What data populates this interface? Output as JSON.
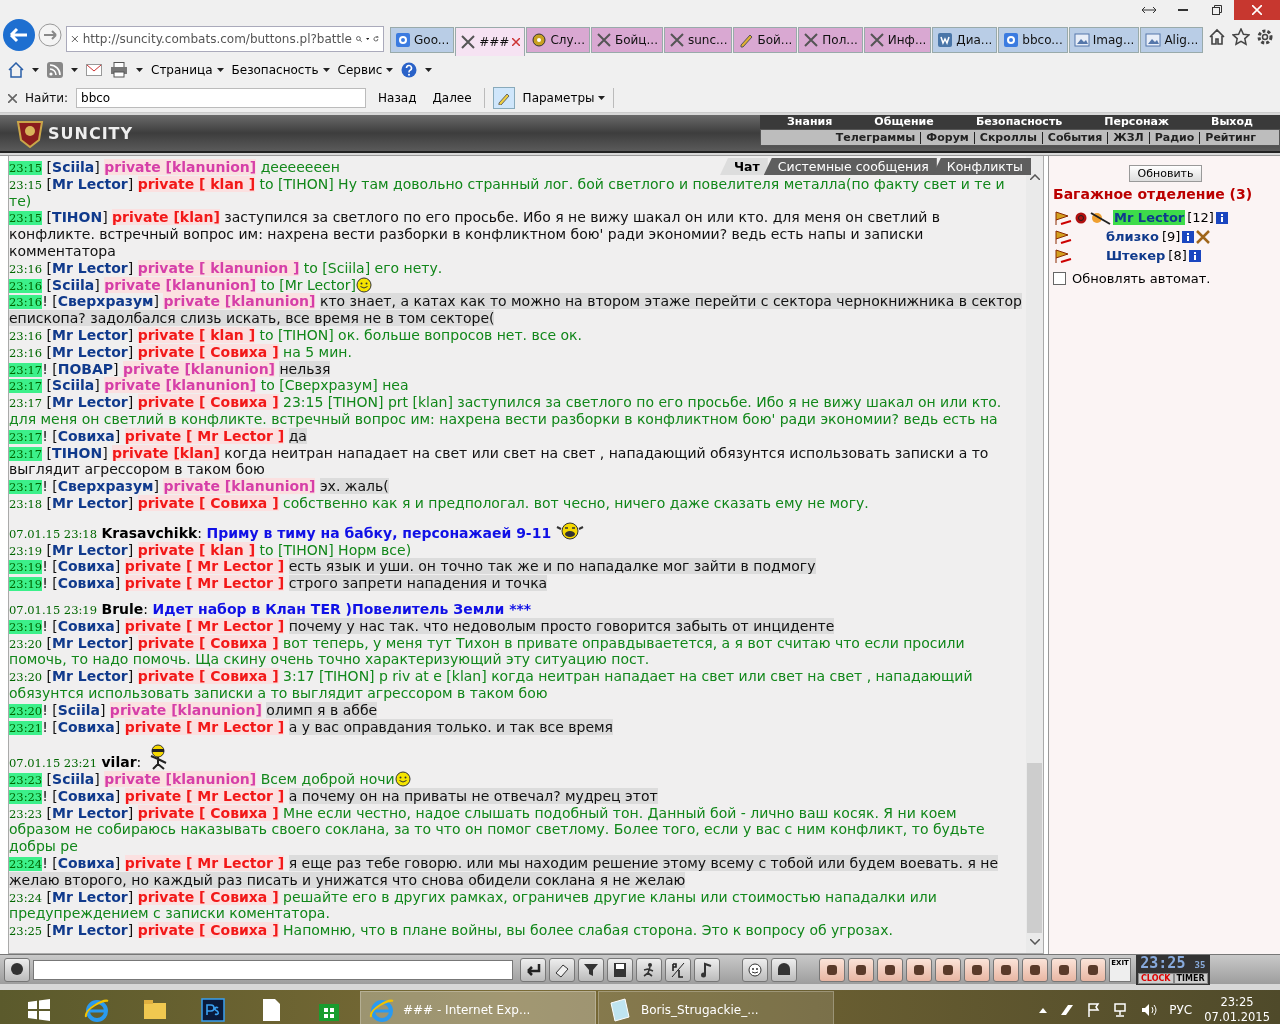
{
  "browser": {
    "url": "http://suncity.combats.com/buttons.pl?battle",
    "tabs": [
      {
        "label": "Goo...",
        "kind": "search",
        "color": "#b9cde6",
        "selected": false
      },
      {
        "label": "###",
        "kind": "swords",
        "color": "#f6e3f3",
        "selected": true
      },
      {
        "label": "Слу...",
        "kind": "gear",
        "color": "#d9a8d2",
        "selected": false
      },
      {
        "label": "Бойц...",
        "kind": "swords",
        "color": "#d9a8d2",
        "selected": false
      },
      {
        "label": "sunc...",
        "kind": "swords",
        "color": "#d9a8d2",
        "selected": false
      },
      {
        "label": "Бой...",
        "kind": "pen",
        "color": "#d9a8d2",
        "selected": false
      },
      {
        "label": "Пол...",
        "kind": "swords",
        "color": "#d9a8d2",
        "selected": false
      },
      {
        "label": "Инф...",
        "kind": "swords",
        "color": "#d9a8d2",
        "selected": false
      },
      {
        "label": "Диа...",
        "kind": "vk",
        "color": "#b9cde6",
        "selected": false
      },
      {
        "label": "bbco...",
        "kind": "search",
        "color": "#b9cde6",
        "selected": false
      },
      {
        "label": "Imag...",
        "kind": "image",
        "color": "#b9cde6",
        "selected": false
      },
      {
        "label": "Alig...",
        "kind": "image",
        "color": "#b9cde6",
        "selected": false
      }
    ],
    "menus": [
      "Страница",
      "Безопасность",
      "Сервис"
    ],
    "find": {
      "label": "Найти:",
      "value": "bbco",
      "prev": "Назад",
      "next": "Далее",
      "options": "Параметры"
    }
  },
  "game": {
    "logo": "SUNCITY",
    "nav_top": [
      "Знания",
      "Общение",
      "Безопасность",
      "Персонаж",
      "Выход"
    ],
    "nav_bottom": [
      "Телеграммы",
      "Форум",
      "Скроллы",
      "События",
      "ЖЗЛ",
      "Радио",
      "Рейтинг"
    ],
    "tabs": [
      {
        "label": "Чат",
        "selected": true
      },
      {
        "label": "Системные сообщения",
        "selected": false
      },
      {
        "label": "Конфликты",
        "selected": false
      }
    ]
  },
  "chat": [
    {
      "kind": "private",
      "time": "23:15",
      "time_marked": true,
      "sender": "[**Sciila**]",
      "channel": {
        "label": "private [klanunion]",
        "color": "#d63fa8"
      },
      "body": {
        "text": "дееееееен",
        "color": "#11871a",
        "shaded": false
      }
    },
    {
      "kind": "private",
      "time": "23:15",
      "time_marked": false,
      "sender": "[**Mr Lector**]",
      "channel": {
        "label": "private [ klan ]",
        "color": "#f21818"
      },
      "body": {
        "text": "to [TIHON] Ну там довольно странный лог. бой светлого и повелителя металла(по факту свет и те и те)",
        "color": "#11871a",
        "shaded": false
      }
    },
    {
      "kind": "private",
      "time": "23:15",
      "time_marked": true,
      "sender": "[**TIHON**]",
      "channel": {
        "label": "private [klan]",
        "color": "#f21818"
      },
      "body": {
        "text": "заступился за светлого по его просьбе. Ибо я не вижу шакал он или кто. для меня он светлий в конфликте. встречный вопрос им: нахрена вести разборки в конфликтном бою' ради экономии? ведь есть напы и записки комментатора",
        "color": "#111111",
        "shaded": false
      }
    },
    {
      "kind": "private",
      "time": "23:16",
      "time_marked": false,
      "sender": "[**Mr Lector**]",
      "channel": {
        "label": "private [ klanunion ]",
        "color": "#d63fa8"
      },
      "body": {
        "text": "to [Sciila] его нету.",
        "color": "#11871a",
        "shaded": false
      }
    },
    {
      "kind": "private",
      "time": "23:16",
      "time_marked": true,
      "sender": "[**Sciila**]",
      "channel": {
        "label": "private [klanunion]",
        "color": "#d63fa8"
      },
      "body": {
        "text": "to [Mr Lector]",
        "color": "#11871a",
        "shaded": false
      },
      "emoticon": {
        "kind": "smile"
      }
    },
    {
      "kind": "private",
      "time": "23:16",
      "time_marked": true,
      "prefix": "!",
      "sender": "[**Сверхразум**]",
      "channel": {
        "label": "private [klanunion]",
        "color": "#d63fa8"
      },
      "body": {
        "text": "кто знает, а катах как то можно на втором этаже перейти с сектора чернокнижника в сектор епископа? задолбался слизь искать, все время не в том секторе(",
        "color": "#111111",
        "shaded": true
      }
    },
    {
      "kind": "private",
      "time": "23:16",
      "time_marked": false,
      "sender": "[**Mr Lector**]",
      "channel": {
        "label": "private [ klan ]",
        "color": "#f21818"
      },
      "body": {
        "text": "to [TIHON] ок. больше вопросов нет. все ок.",
        "color": "#11871a",
        "shaded": false
      }
    },
    {
      "kind": "private",
      "time": "23:16",
      "time_marked": false,
      "sender": "[**Mr Lector**]",
      "channel": {
        "label": "private [ Совиха ]",
        "color": "#f21818"
      },
      "body": {
        "text": "на 5 мин.",
        "color": "#11871a",
        "shaded": false
      }
    },
    {
      "kind": "private",
      "time": "23:17",
      "time_marked": true,
      "prefix": "!",
      "sender": "[**ПОВАР**]",
      "channel": {
        "label": "private [klanunion]",
        "color": "#d63fa8"
      },
      "body": {
        "text": "нельзя",
        "color": "#111111",
        "shaded": true
      }
    },
    {
      "kind": "private",
      "time": "23:17",
      "time_marked": true,
      "sender": "[**Sciila**]",
      "channel": {
        "label": "private [klanunion]",
        "color": "#d63fa8"
      },
      "body": {
        "text": "to [Сверхразум] неа",
        "color": "#11871a",
        "shaded": false
      }
    },
    {
      "kind": "private",
      "time": "23:17",
      "time_marked": false,
      "sender": "[**Mr Lector**]",
      "channel": {
        "label": "private [ Совиха ]",
        "color": "#f21818"
      },
      "body": {
        "text": "23:15 [TIHON] prt [klan] заступился за светлого по его просьбе. Ибо я не вижу шакал он или кто. для меня он светлий в конфликте. встречный вопрос им: нахрена вести разборки в конфликтном бою' ради экономии? ведь есть на",
        "color": "#11871a",
        "shaded": false
      }
    },
    {
      "kind": "private",
      "time": "23:17",
      "time_marked": true,
      "prefix": "!",
      "sender": "[**Совиха**]",
      "channel": {
        "label": "private [ Mr Lector ]",
        "color": "#f21818"
      },
      "body": {
        "text": "да",
        "color": "#111111",
        "shaded": true
      }
    },
    {
      "kind": "private",
      "time": "23:17",
      "time_marked": true,
      "sender": "[**TIHON**]",
      "channel": {
        "label": "private [klan]",
        "color": "#f21818"
      },
      "body": {
        "text": "когда неитран нападает на свет или свет на свет , нападающий обязунтся использовать записки а то выглядит агрессором в таком бою",
        "color": "#111111",
        "shaded": false
      }
    },
    {
      "kind": "private",
      "time": "23:17",
      "time_marked": true,
      "prefix": "!",
      "sender": "[**Сверхразум**]",
      "channel": {
        "label": "private [klanunion]",
        "color": "#d63fa8"
      },
      "body": {
        "text": "эх. жаль(",
        "color": "#111111",
        "shaded": true
      }
    },
    {
      "kind": "private",
      "time": "23:18",
      "time_marked": false,
      "sender": "[**Mr Lector**]",
      "channel": {
        "label": "private [ Совиха ]",
        "color": "#f21818"
      },
      "body": {
        "text": "собственно как я и предпологал. вот чесно, ничего даже сказать ему не могу.",
        "color": "#11871a",
        "shaded": false
      }
    },
    {
      "kind": "broadcast",
      "time": "07.01.15 23:18",
      "sender": "**Krasavchikk**:",
      "text": "Приму в тиму на бабку, персонажаей 9-11",
      "emoticon": {
        "kind": "laugh"
      }
    },
    {
      "kind": "private",
      "time": "23:19",
      "time_marked": false,
      "sender": "[**Mr Lector**]",
      "channel": {
        "label": "private [ klan ]",
        "color": "#f21818"
      },
      "body": {
        "text": "to [TIHON] Норм все)",
        "color": "#11871a",
        "shaded": false
      }
    },
    {
      "kind": "private",
      "time": "23:19",
      "time_marked": true,
      "prefix": "!",
      "sender": "[**Совиха**]",
      "channel": {
        "label": "private [ Mr Lector ]",
        "color": "#f21818"
      },
      "body": {
        "text": "есть язык и уши. он точно так же и по нападалке мог зайти в подмогу",
        "color": "#111111",
        "shaded": true
      }
    },
    {
      "kind": "private",
      "time": "23:19",
      "time_marked": true,
      "prefix": "!",
      "sender": "[**Совиха**]",
      "channel": {
        "label": "private [ Mr Lector ]",
        "color": "#f21818"
      },
      "body": {
        "text": "строго запрети нападения и точка",
        "color": "#111111",
        "shaded": true
      }
    },
    {
      "kind": "broadcast",
      "time": "07.01.15 23:19",
      "sender": "**Brule**:",
      "text": "Идет набор в Клан TER )Повелитель Земли ***"
    },
    {
      "kind": "private",
      "time": "23:19",
      "time_marked": true,
      "prefix": "!",
      "sender": "[**Совиха**]",
      "channel": {
        "label": "private [ Mr Lector ]",
        "color": "#f21818"
      },
      "body": {
        "text": "почему у нас так. что недоволым просто говорится забыть от инциденте",
        "color": "#111111",
        "shaded": true
      }
    },
    {
      "kind": "private",
      "time": "23:20",
      "time_marked": false,
      "sender": "[**Mr Lector**]",
      "channel": {
        "label": "private [ Совиха ]",
        "color": "#f21818"
      },
      "body": {
        "text": "вот теперь, у меня тут Тихон в привате оправдываетется, а я вот считаю что если просили помочь, то надо помочь. Ща скину очень точно характеризующий эту ситуацию пост.",
        "color": "#11871a",
        "shaded": false
      }
    },
    {
      "kind": "private",
      "time": "23:20",
      "time_marked": false,
      "sender": "[**Mr Lector**]",
      "channel": {
        "label": "private [ Совиха ]",
        "color": "#f21818"
      },
      "body": {
        "text": "3:17 [TIHON] p riv at e [klan] когда неитран нападает на свет или свет на свет , нападающий обязунтся использовать записки а то выглядит агрессором в таком бою",
        "color": "#11871a",
        "shaded": false
      }
    },
    {
      "kind": "private",
      "time": "23:20",
      "time_marked": true,
      "prefix": "!",
      "sender": "[**Sciila**]",
      "channel": {
        "label": "private [klanunion]",
        "color": "#d63fa8"
      },
      "body": {
        "text": "олимп я в аббе",
        "color": "#111111",
        "shaded": true
      }
    },
    {
      "kind": "private",
      "time": "23:21",
      "time_marked": true,
      "prefix": "!",
      "sender": "[**Совиха**]",
      "channel": {
        "label": "private [ Mr Lector ]",
        "color": "#f21818"
      },
      "body": {
        "text": "а у вас оправдания только. и так все время",
        "color": "#111111",
        "shaded": true
      }
    },
    {
      "kind": "broadcast",
      "time": "07.01.15 23:21",
      "sender": "**vilar**:",
      "emoticon": {
        "kind": "dancer"
      }
    },
    {
      "kind": "private",
      "time": "23:23",
      "time_marked": true,
      "sender": "[**Sciila**]",
      "channel": {
        "label": "private [klanunion]",
        "color": "#d63fa8"
      },
      "body": {
        "text": "Всем доброй ночи",
        "color": "#11871a",
        "shaded": false
      },
      "emoticon": {
        "kind": "smile"
      }
    },
    {
      "kind": "private",
      "time": "23:23",
      "time_marked": true,
      "prefix": "!",
      "sender": "[**Совиха**]",
      "channel": {
        "label": "private [ Mr Lector ]",
        "color": "#f21818"
      },
      "body": {
        "text": "а почему он на приваты не отвечал? мудрец этот",
        "color": "#111111",
        "shaded": true
      }
    },
    {
      "kind": "private",
      "time": "23:23",
      "time_marked": false,
      "sender": "[**Mr Lector**]",
      "channel": {
        "label": "private [ Совиха ]",
        "color": "#f21818"
      },
      "body": {
        "text": "Мне если честно, надое слышать подобный тон. Данный бой - лично ваш косяк. Я ни коем образом не собираюсь наказывать своего соклана, за то что он помог светлому. Более того, если у вас с ним конфликт, то будьте добры ре",
        "color": "#11871a",
        "shaded": false
      }
    },
    {
      "kind": "private",
      "time": "23:24",
      "time_marked": true,
      "prefix": "!",
      "sender": "[**Совиха**]",
      "channel": {
        "label": "private [ Mr Lector ]",
        "color": "#f21818"
      },
      "body": {
        "text": "я еще раз тебе говорю. или мы находим решение этому всему с тобой или будем воевать. я не желаю второго, но каждый раз писать и унижатся что снова обидели соклана я не желаю",
        "color": "#111111",
        "shaded": true
      }
    },
    {
      "kind": "private",
      "time": "23:24",
      "time_marked": false,
      "sender": "[**Mr Lector**]",
      "channel": {
        "label": "private [ Совиха ]",
        "color": "#f21818"
      },
      "body": {
        "text": "решайте его в других рамках, ограничев другие кланы или стоимостью нападалки или предупреждением с записки коментатора.",
        "color": "#11871a",
        "shaded": false
      }
    },
    {
      "kind": "private",
      "time": "23:25",
      "time_marked": false,
      "sender": "[**Mr Lector**]",
      "channel": {
        "label": "private [ Совиха ]",
        "color": "#f21818"
      },
      "body": {
        "text": "Напомню, что в плане войны, вы более слабая сторона. Это к вопросу об угрозах.",
        "color": "#11871a",
        "shaded": false
      }
    }
  ],
  "room": {
    "refresh": "Обновить",
    "title": "Багажное отделение (3)",
    "users": [
      {
        "name": "Mr Lector",
        "level": "[12]",
        "selected": true,
        "clan_emblem": true,
        "in_battle": false
      },
      {
        "name": "близко",
        "level": "[9]",
        "selected": false,
        "clan_emblem": false,
        "in_battle": true
      },
      {
        "name": "Штекер",
        "level": "[8]",
        "selected": false,
        "clan_emblem": false,
        "in_battle": false
      }
    ],
    "auto_refresh": {
      "label": "Обновлять автомат.",
      "checked": false
    }
  },
  "clock": {
    "time": "23:25",
    "seconds": "35",
    "exit": "EXIT",
    "clock_label": "CLOCK",
    "timer_label": "TIMER"
  },
  "taskbar": {
    "windows": [
      {
        "label": "### - Internet Exp...",
        "kind": "browser",
        "selected": true
      },
      {
        "label": "Boris_Strugackie_...",
        "kind": "document",
        "selected": false
      }
    ],
    "language": "РУС",
    "time": "23:25",
    "date": "07.01.2015"
  }
}
